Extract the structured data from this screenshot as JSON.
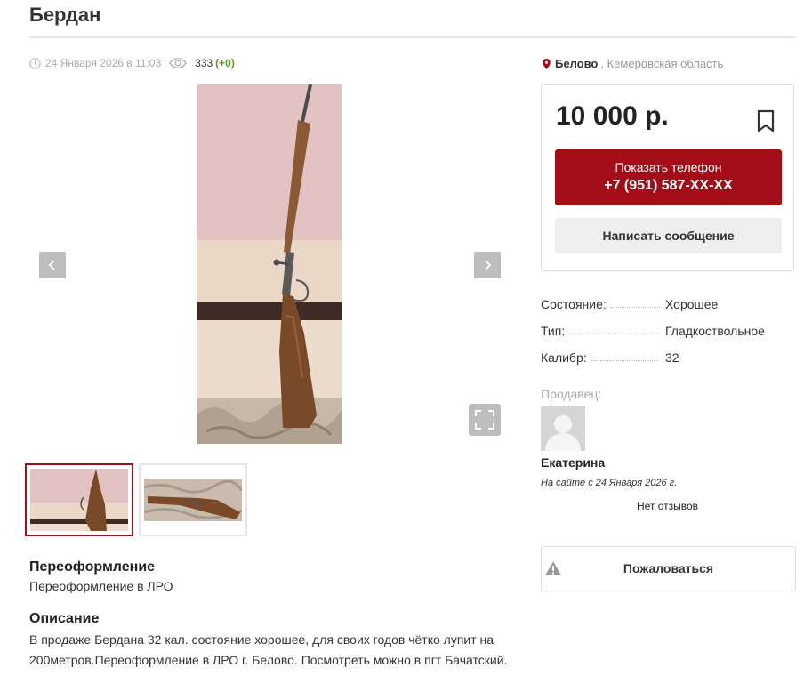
{
  "listing": {
    "title": "Бердан",
    "date": "24 Января 2026 в 11:03",
    "views": "333",
    "views_inc": "(+0)"
  },
  "location": {
    "city": "Белово",
    "region": ", Кемеровская область"
  },
  "price": {
    "value": "10 000 р.",
    "phone_label": "Показать телефон",
    "phone": "+7 (951) 587-XX-XX",
    "message": "Написать сообщение"
  },
  "properties": [
    {
      "key": "Состояние:",
      "value": "Хорошее"
    },
    {
      "key": "Тип:",
      "value": "Гладкоствольное"
    },
    {
      "key": "Калибр:",
      "value": "32"
    }
  ],
  "seller": {
    "heading": "Продавец:",
    "name": "Екатерина",
    "since": "На сайте с 24 Января 2026 г.",
    "reviews": "Нет отзывов"
  },
  "report": {
    "label": "Пожаловаться"
  },
  "reregistration": {
    "heading": "Переоформление",
    "text": "Переоформление в ЛРО"
  },
  "description": {
    "heading": "Описание",
    "text": "В продаже Бердана 32 кал. состояние хорошее, для своих годов чётко лупит на 200метров.Переоформление в ЛРО г. Белово. Посмотреть можно в пгт Бачатский."
  },
  "colors": {
    "accent": "#a30d18",
    "green": "#5a9e2f"
  },
  "icons": [
    "clock-icon",
    "eye-icon",
    "location-pin-icon",
    "bookmark-icon",
    "chevron-left-icon",
    "chevron-right-icon",
    "fullscreen-icon",
    "warning-icon"
  ]
}
